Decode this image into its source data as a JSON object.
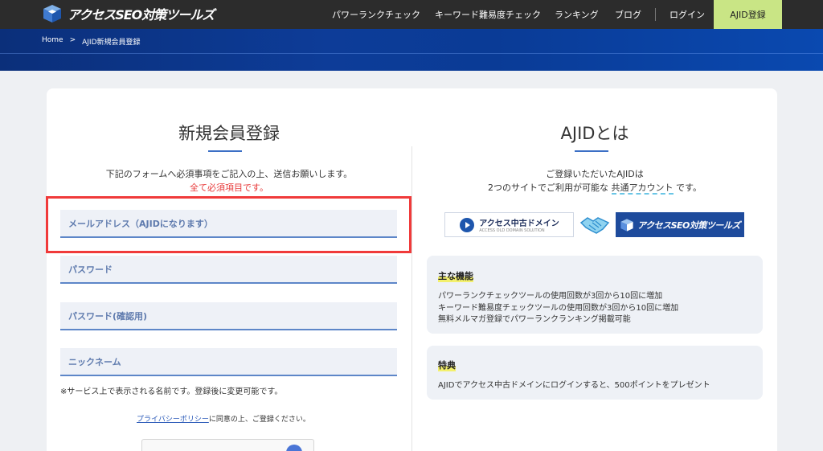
{
  "header": {
    "logo_text": "アクセスSEO対策ツールズ",
    "nav": [
      "パワーランクチェック",
      "キーワード難易度チェック",
      "ランキング",
      "ブログ",
      "ログイン"
    ],
    "register_label": "AJID登録"
  },
  "breadcrumb": {
    "home": "Home",
    "sep": ">",
    "current": "AJID新規会員登録"
  },
  "form": {
    "title": "新規会員登録",
    "intro": "下記のフォームへ必須事項をご記入の上、送信お願いします。",
    "required_note": "全て必須項目です。",
    "fields": {
      "email": "メールアドレス（AJIDになります）",
      "password": "パスワード",
      "password_confirm": "パスワード(確認用)",
      "nickname": "ニックネーム"
    },
    "nickname_note": "※サービス上で表示される名前です。登録後に変更可能です。",
    "privacy_link": "プライバシーポリシー",
    "privacy_suffix": "に同意の上、ご登録ください。"
  },
  "about": {
    "title": "AJIDとは",
    "line1": "ご登録いただいたAJIDは",
    "line2_prefix": "2つのサイトでご利用が可能な",
    "line2_marker": "共通アカウント",
    "line2_suffix": "です。",
    "badge_left": "アクセス中古ドメイン",
    "badge_left_sub": "ACCESS OLD DOMAIN SOLUTION",
    "badge_right": "アクセスSEO対策ツールズ",
    "features": {
      "heading": "主な機能",
      "lines": [
        "パワーランクチェックツールの使用回数が3回から10回に増加",
        "キーワード難易度チェックツールの使用回数が3回から10回に増加",
        "無料メルマガ登録でパワーランクランキング掲載可能"
      ]
    },
    "perks": {
      "heading": "特典",
      "lines": [
        "AJIDでアクセス中古ドメインにログインすると、500ポイントをプレゼント"
      ]
    }
  },
  "colors": {
    "accent": "#3b6fc5",
    "register_bg": "#c9e585",
    "hero": "#0d3c98",
    "highlight": "#f03a3a",
    "required": "#e83b3b"
  }
}
